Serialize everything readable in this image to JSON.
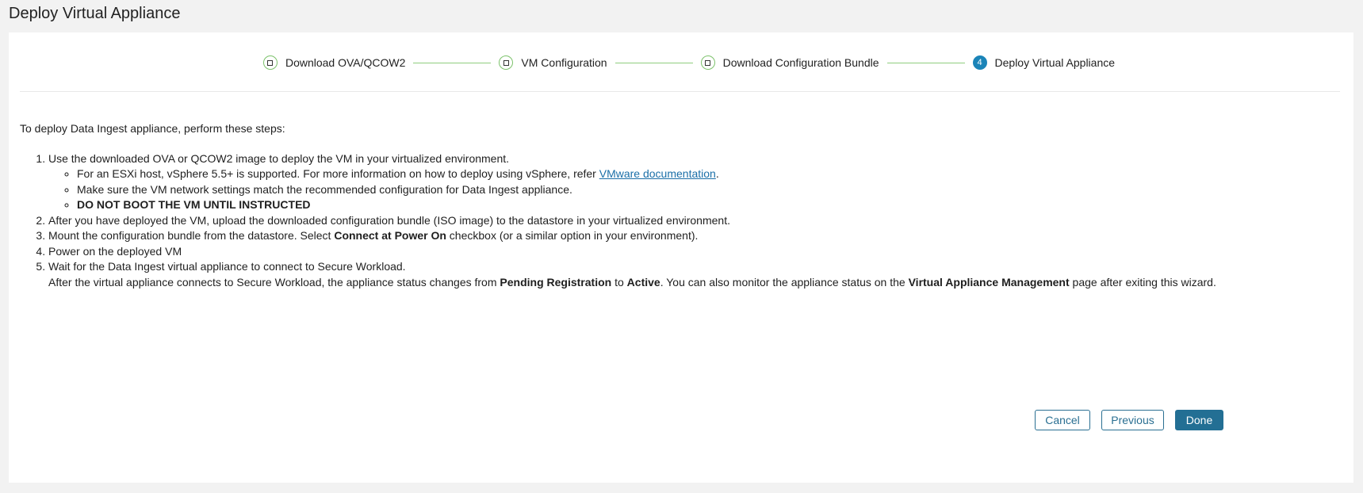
{
  "title": "Deploy Virtual Appliance",
  "stepper": [
    {
      "label": "Download OVA/QCOW2",
      "state": "complete"
    },
    {
      "label": "VM Configuration",
      "state": "complete"
    },
    {
      "label": "Download Configuration Bundle",
      "state": "complete"
    },
    {
      "label": "Deploy Virtual Appliance",
      "state": "current",
      "number": "4"
    }
  ],
  "colors": {
    "accent": "#1b84b8",
    "complete": "#7cc26b",
    "button": "#236f94"
  },
  "content": {
    "intro": "To deploy Data Ingest appliance, perform these steps:",
    "step1": "Use the downloaded OVA or QCOW2 image to deploy the VM in your virtualized environment.",
    "step1_sub1_pre": "For an ESXi host, vSphere 5.5+ is supported. For more information on how to deploy using vSphere, refer ",
    "step1_sub1_link": "VMware documentation",
    "step1_sub1_post": ".",
    "step1_sub2": "Make sure the VM network settings match the recommended configuration for Data Ingest appliance.",
    "step1_sub3": "DO NOT BOOT THE VM UNTIL INSTRUCTED",
    "step2": "After you have deployed the VM, upload the downloaded configuration bundle (ISO image) to the datastore in your virtualized environment.",
    "step3_pre": "Mount the configuration bundle from the datastore. Select ",
    "step3_bold": "Connect at Power On",
    "step3_post": " checkbox (or a similar option in your environment).",
    "step4": "Power on the deployed VM",
    "step5": "Wait for the Data Ingest virtual appliance to connect to Secure Workload.",
    "step5_note_a": "After the virtual appliance connects to Secure Workload, the appliance status changes from ",
    "step5_note_b": "Pending Registration",
    "step5_note_c": " to ",
    "step5_note_d": "Active",
    "step5_note_e": ". You can also monitor the appliance status on the ",
    "step5_note_f": "Virtual Appliance Management",
    "step5_note_g": " page after exiting this wizard."
  },
  "buttons": {
    "cancel": "Cancel",
    "previous": "Previous",
    "done": "Done"
  }
}
